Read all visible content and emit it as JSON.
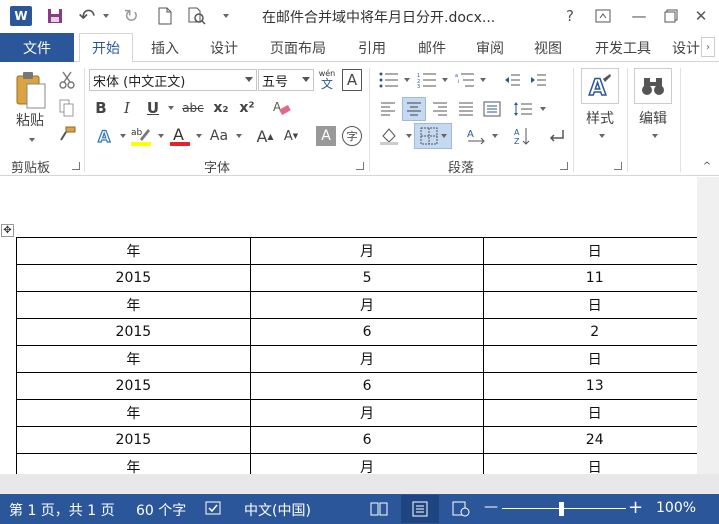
{
  "app": {
    "title": "在邮件合并域中将年月日分开.docx...",
    "logo": "W"
  },
  "titlebar": {
    "undo": "↶",
    "redo": "↻",
    "help": "?",
    "restore": "⧉",
    "minimize": "—",
    "close": "✕"
  },
  "tabs": {
    "file": "文件",
    "items": [
      "开始",
      "插入",
      "设计",
      "页面布局",
      "引用",
      "邮件",
      "审阅",
      "视图",
      "开发工具",
      "设计"
    ]
  },
  "ribbon": {
    "clipboard": {
      "paste": "粘贴",
      "label": "剪贴板"
    },
    "font": {
      "family": "宋体 (中文正文)",
      "size": "五号",
      "bold": "B",
      "italic": "I",
      "underline": "U",
      "strike": "abc",
      "sub": "x₂",
      "sup": "x²",
      "case": "Aa",
      "label": "字体",
      "phonetic_top": "wén",
      "phonetic_bottom": "文",
      "charborder": "A",
      "grow": "A",
      "shrink": "A",
      "shade": "A",
      "enclose": "字"
    },
    "paragraph": {
      "label": "段落"
    },
    "styles": {
      "label": "样式"
    },
    "editing": {
      "label": "编辑"
    }
  },
  "table": {
    "rows": [
      [
        "年",
        "月",
        "日"
      ],
      [
        "2015",
        "5",
        "11"
      ],
      [
        "年",
        "月",
        "日"
      ],
      [
        "2015",
        "6",
        "2"
      ],
      [
        "年",
        "月",
        "日"
      ],
      [
        "2015",
        "6",
        "13"
      ],
      [
        "年",
        "月",
        "日"
      ],
      [
        "2015",
        "6",
        "24"
      ],
      [
        "年",
        "月",
        "日"
      ]
    ]
  },
  "status": {
    "page": "第 1 页，共 1 页",
    "words": "60 个字",
    "language": "中文(中国)",
    "zoom": "100%",
    "zoom_out": "—",
    "zoom_in": "+"
  },
  "colors": {
    "accent": "#2b579a",
    "highlight": "#ffff00",
    "font_color": "#e3242b"
  }
}
